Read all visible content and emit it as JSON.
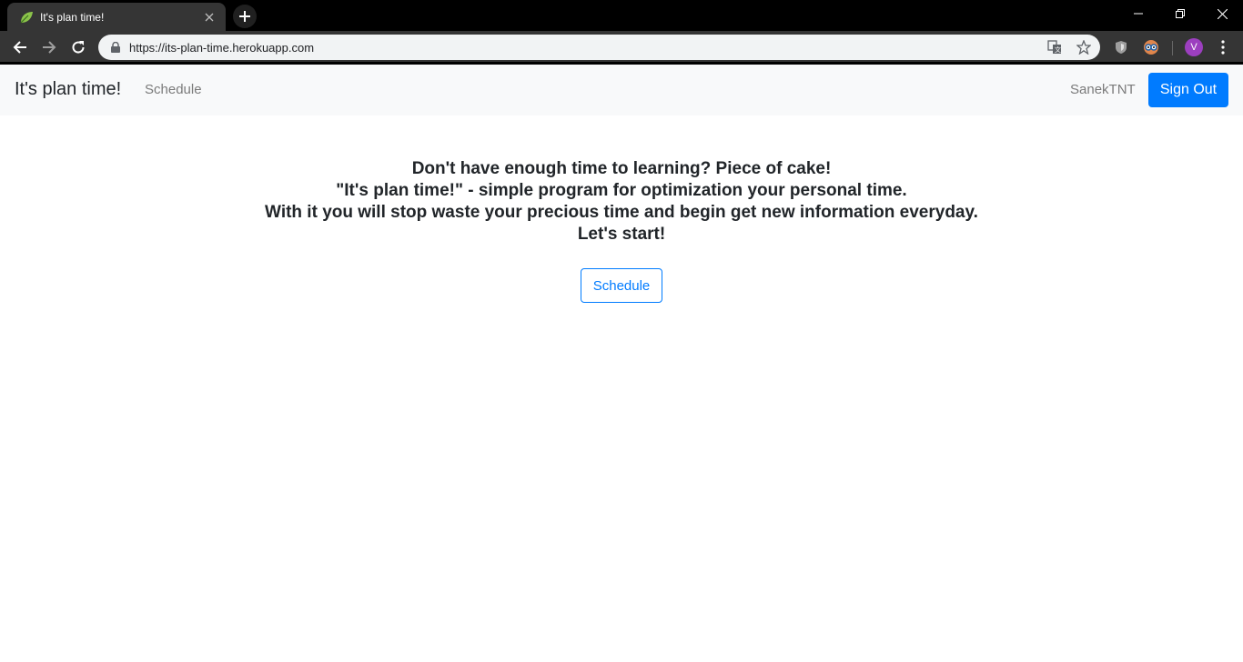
{
  "browser": {
    "tab_title": "It's plan time!",
    "url": "https://its-plan-time.herokuapp.com",
    "profile_initial": "V"
  },
  "navbar": {
    "brand": "It's plan time!",
    "schedule_link": "Schedule",
    "username": "SanekTNT",
    "signout_label": "Sign Out"
  },
  "hero": {
    "line1": "Don't have enough time to learning? Piece of cake!",
    "line2": "\"It's plan time!\" - simple program for optimization your personal time.",
    "line3": "With it you will stop waste your precious time and begin get new information everyday.",
    "line4": "Let's start!",
    "cta_label": "Schedule"
  },
  "colors": {
    "primary": "#007bff",
    "navbar_bg": "#f8f9fa",
    "text": "#212529",
    "muted": "#7b7b7b"
  }
}
